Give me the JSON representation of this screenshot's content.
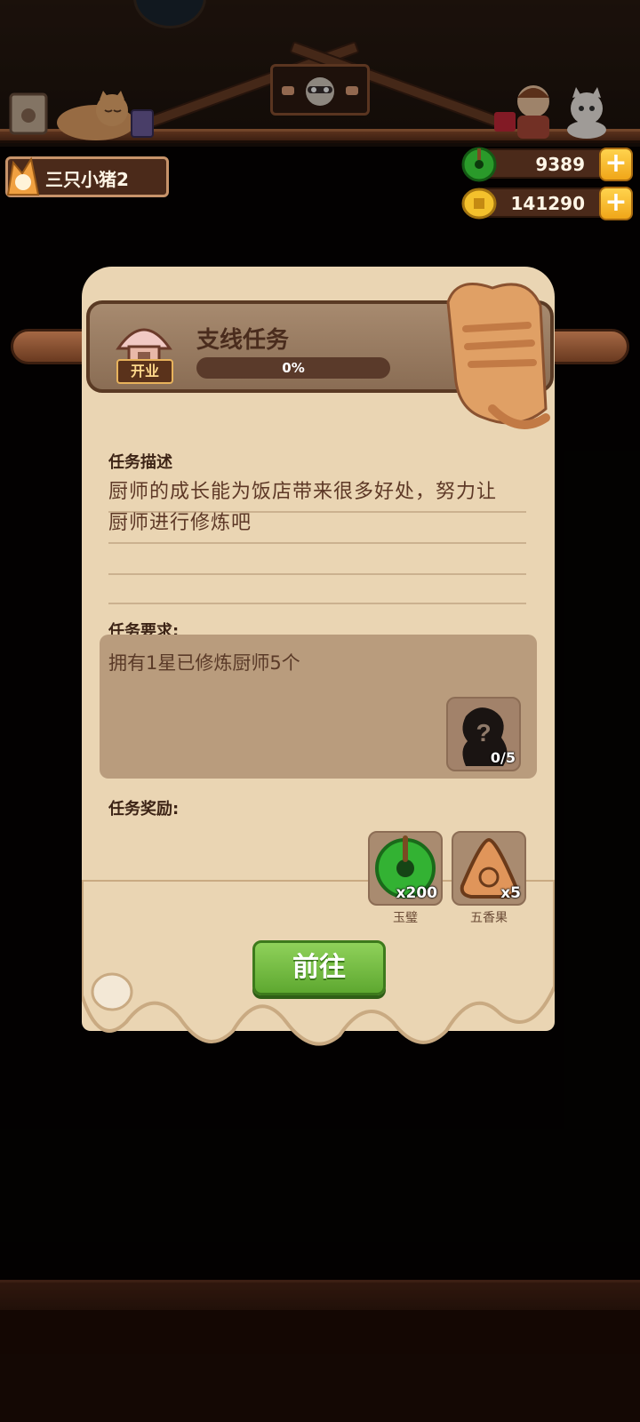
{
  "hud": {
    "restaurant_name": "三只小猪2",
    "jade_amount": "9389",
    "coin_amount": "141290",
    "plus_label": "+"
  },
  "quest": {
    "title": "支线任务",
    "badge": "开业",
    "progress_text": "0%",
    "progress_value": 0,
    "description_label": "任务描述",
    "description_line1": "厨师的成长能为饭店带来很多好处，努力让",
    "description_line2": "厨师进行修炼吧",
    "requirement_label": "任务要求:",
    "requirement_text": "拥有1星已修炼厨师5个",
    "requirement_progress": "0/5",
    "requirement_icon": "?",
    "reward_label": "任务奖励:",
    "rewards": [
      {
        "name": "玉璧",
        "quantity": "x200",
        "icon": "jade-disc-icon"
      },
      {
        "name": "五香果",
        "quantity": "x5",
        "icon": "spice-fruit-icon"
      }
    ],
    "go_button": "前往"
  },
  "colors": {
    "parchment": "#ead5b3",
    "button_green": "#7bc84b",
    "text_brown": "#5d3826"
  }
}
